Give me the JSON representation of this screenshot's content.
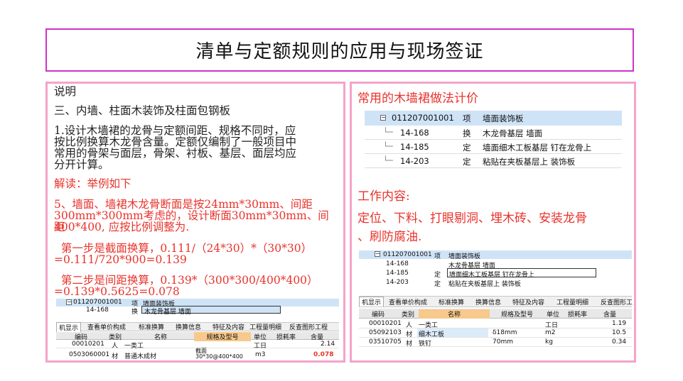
{
  "title": "清单与定额规则的应用与现场签证",
  "left": {
    "heading": "说明",
    "section": "三、内墙、柱面木装饰及柱面包钢板",
    "para1": [
      "1.设计木墙裙的龙骨与定额间距、规格不同时，应",
      "按比例换算木龙骨含量。定额仅编制了一般项目中",
      "常用的骨架与面层，骨架、衬板、基层、面层均应",
      "分开计算。"
    ],
    "interp": "解读：举例如下",
    "rule5": [
      "5、墙面、墙裙木龙骨断面是按24mm*30mm、间距",
      "300mm*300mm考虑的，设计断面30mm*30mm、间距",
      "400*400, 应按比例调整为."
    ],
    "step1": [
      "  第一步是截面换算，0.111/（24*30）*（30*30）",
      "=0.111/720*900=0.139"
    ],
    "step2": [
      "  第二步是间距换算，0.139*（300*300/400*400）",
      "=0.139*0.5625=0.078"
    ],
    "shot": {
      "tree": [
        {
          "code": "011207001001",
          "type": "项",
          "name": "墙面装饰板"
        },
        {
          "code": "14-168",
          "type": "换",
          "name": "木龙骨基层 墙面"
        }
      ],
      "tabs": [
        "机显示",
        "查看单价构成",
        "标准换算",
        "换算信息",
        "特征及内容",
        "工程量明细",
        "反查图形工程"
      ],
      "headers": [
        "编码",
        "类别",
        "名称",
        "规格及型号",
        "单位",
        "损耗率",
        "含量"
      ],
      "rows": [
        [
          "00010201",
          "人",
          "一类工",
          "",
          "工日",
          "",
          "2.14"
        ],
        [
          "0503060001",
          "材",
          "普通木成材",
          "截面\n30*30@400*400",
          "m3",
          "",
          "0.078"
        ]
      ]
    }
  },
  "right": {
    "heading": "常用的木墙裙做法计价",
    "tree1": [
      {
        "code": "011207001001",
        "type": "项",
        "name": "墙面装饰板"
      },
      {
        "code": "14-168",
        "type": "换",
        "name": "木龙骨基层 墙面"
      },
      {
        "code": "14-185",
        "type": "定",
        "name": "墙面细木工板基层 钉在龙骨上"
      },
      {
        "code": "14-203",
        "type": "定",
        "name": "粘贴在夹板基层上 装饰板"
      }
    ],
    "work_heading": "工作内容:",
    "work_content": [
      "定位、下料、打眼剔洞、埋木砖、安装龙骨",
      "、刷防腐油."
    ],
    "shot": {
      "tree": [
        {
          "code": "011207001001",
          "type": "项",
          "name": "墙面装饰板"
        },
        {
          "code": "14-168",
          "type": "",
          "name": "木龙骨基层 墙面"
        },
        {
          "code": "14-185",
          "type": "定",
          "name": "墙面细木工板基层 钉在龙骨上"
        },
        {
          "code": "14-203",
          "type": "定",
          "name": "粘贴在夹板基层上 装饰板"
        }
      ],
      "tabs": [
        "机显示",
        "查看单价构成",
        "标准换算",
        "换算信息",
        "特征及内容",
        "工程量明细",
        "反查图形工"
      ],
      "headers": [
        "编码",
        "类别",
        "名称",
        "规格及型号",
        "单位",
        "损耗率",
        "含量"
      ],
      "rows": [
        [
          "00010201",
          "人",
          "一类工",
          "",
          "工日",
          "",
          "1.19"
        ],
        [
          "05092103",
          "材",
          "细木工板",
          "δ18mm",
          "m2",
          "",
          "10.5"
        ],
        [
          "03510705",
          "材",
          "铁钉",
          "70mm",
          "kg",
          "",
          "0.34"
        ]
      ]
    }
  },
  "colors": {
    "accent_red": "#e8332c",
    "title_border": "#cc33cc",
    "panel_border": "#f4a3c9",
    "selection_blue": "#cfe3f7",
    "header_orange": "#f8c98c"
  }
}
